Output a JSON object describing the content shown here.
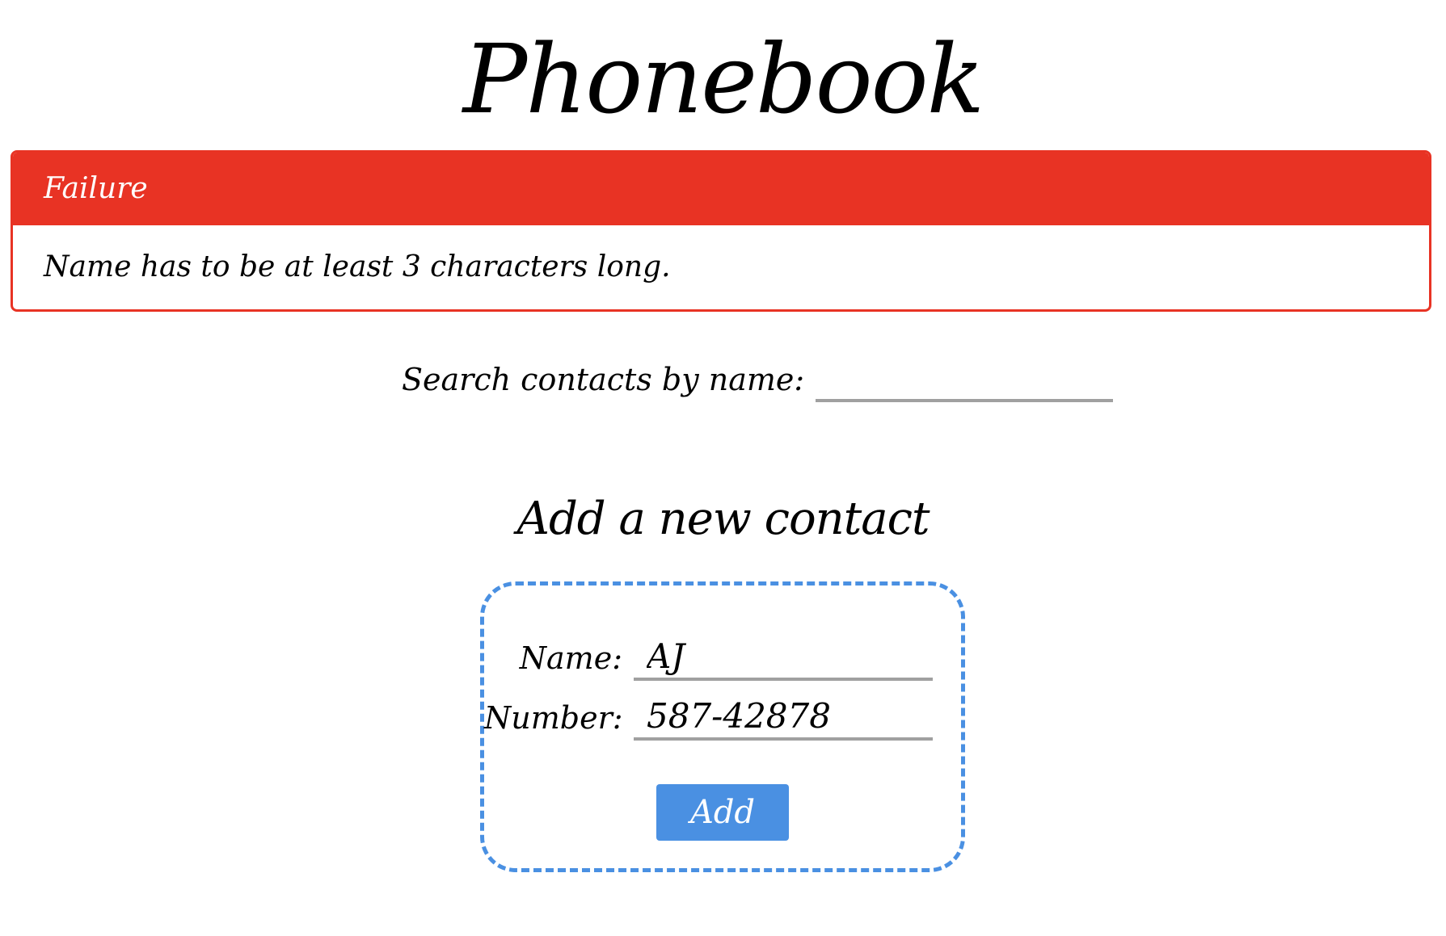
{
  "app": {
    "title": "Phonebook"
  },
  "notification": {
    "header": "Failure",
    "message": "Name has to be at least 3 characters long.",
    "color": "#e83324"
  },
  "search": {
    "label": "Search contacts by name:",
    "value": ""
  },
  "add_contact": {
    "title": "Add a new contact",
    "name_label": "Name:",
    "name_value": "AJ",
    "number_label": "Number:",
    "number_value": "587-42878",
    "button_label": "Add",
    "accent_color": "#4a90e2"
  }
}
